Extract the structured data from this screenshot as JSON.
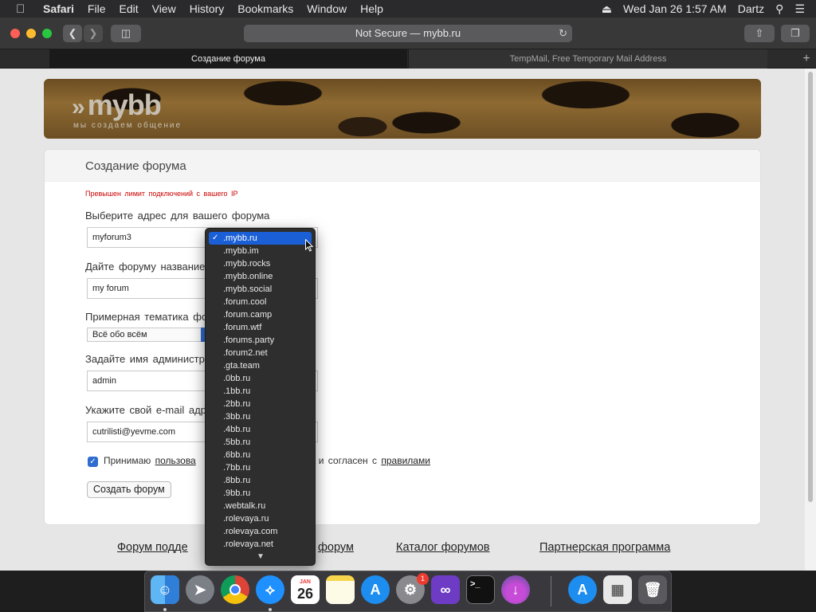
{
  "menubar": {
    "app": "Safari",
    "items": [
      "File",
      "Edit",
      "View",
      "History",
      "Bookmarks",
      "Window",
      "Help"
    ],
    "datetime": "Wed Jan 26  1:57 AM",
    "user": "Dartz"
  },
  "toolbar": {
    "address": "Not Secure — mybb.ru"
  },
  "tabs": [
    {
      "label": "Создание форума"
    },
    {
      "label": "TempMail, Free Temporary Mail Address"
    }
  ],
  "banner": {
    "logo": "mybb",
    "slogan": "мы создаем общение"
  },
  "form": {
    "title": "Создание форума",
    "error": "Превышен лимит подключений с вашего IP",
    "address_label": "Выберите адрес для вашего форума",
    "address_value": "myforum3",
    "name_label": "Дайте форуму название",
    "name_value": "my forum",
    "topic_label": "Примерная тематика фо",
    "topic_value": "Всё обо всём",
    "admin_label": "Задайте имя администр",
    "admin_value": "admin",
    "email_label": "Укажите свой e-mail адр",
    "email_value": "cutrilisti@yevme.com",
    "agree_prefix": "Принимаю",
    "agree_link1": "пользова",
    "agree_mid": "и согласен с",
    "agree_link2": "правилами",
    "submit": "Создать форум"
  },
  "footer_links": [
    "Форум подде",
    "форум",
    "Каталог форумов",
    "Партнерская программа"
  ],
  "dropdown": {
    "selected": ".mybb.ru",
    "options": [
      ".mybb.ru",
      ".mybb.im",
      ".mybb.rocks",
      ".mybb.online",
      ".mybb.social",
      ".forum.cool",
      ".forum.camp",
      ".forum.wtf",
      ".forums.party",
      ".forum2.net",
      ".gta.team",
      ".0bb.ru",
      ".1bb.ru",
      ".2bb.ru",
      ".3bb.ru",
      ".4bb.ru",
      ".5bb.ru",
      ".6bb.ru",
      ".7bb.ru",
      ".8bb.ru",
      ".9bb.ru",
      ".webtalk.ru",
      ".rolevaya.ru",
      ".rolevaya.com",
      ".rolevaya.net"
    ]
  },
  "dock": {
    "calendar_month": "JAN",
    "calendar_day": "26",
    "settings_badge": "1",
    "apps": [
      "finder-icon",
      "launchpad-icon",
      "chrome-icon",
      "safari-icon",
      "calendar-icon",
      "notes-icon",
      "app-store-icon",
      "system-preferences-icon",
      "visual-studio-icon",
      "terminal-icon",
      "installer-icon",
      "app-store-downloads-icon",
      "file-icon",
      "trash-icon"
    ]
  },
  "colors": {
    "accent_blue": "#1a5fd6",
    "error_red": "#cc0000"
  }
}
